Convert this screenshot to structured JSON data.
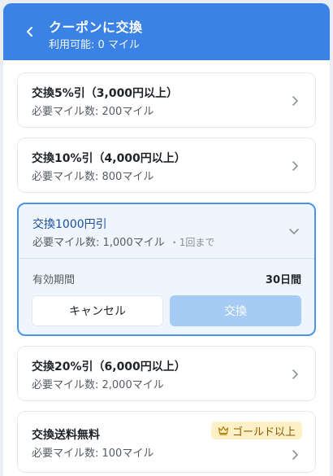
{
  "header": {
    "title": "クーポンに交換",
    "subtitle": "利用可能: 0 マイル"
  },
  "coupons": [
    {
      "title": "交換5%引（3,000円以上）",
      "sub": "必要マイル数: 200マイル"
    },
    {
      "title": "交換10%引（4,000円以上）",
      "sub": "必要マイル数: 800マイル"
    },
    {
      "title": "交換1000円引",
      "sub": "必要マイル数: 1,000マイル",
      "limit": "・1回まで",
      "period_label": "有効期間",
      "period_value": "30日間",
      "cancel_label": "キャンセル",
      "exchange_label": "交換"
    },
    {
      "title": "交換20%引（6,000円以上）",
      "sub": "必要マイル数: 2,000マイル"
    },
    {
      "title": "交換送料無料",
      "sub": "必要マイル数: 100マイル",
      "badge": "ゴールド以上"
    }
  ],
  "colors": {
    "header_bg": "#3a82e4",
    "accent_border": "#4a93ea",
    "exchange_disabled": "#a6cbf5",
    "badge_bg": "#fdf0c7"
  },
  "icons": {
    "back": "chevron-left-icon",
    "row": "chevron-right-icon",
    "expanded": "chevron-down-icon",
    "badge": "crown-icon"
  }
}
